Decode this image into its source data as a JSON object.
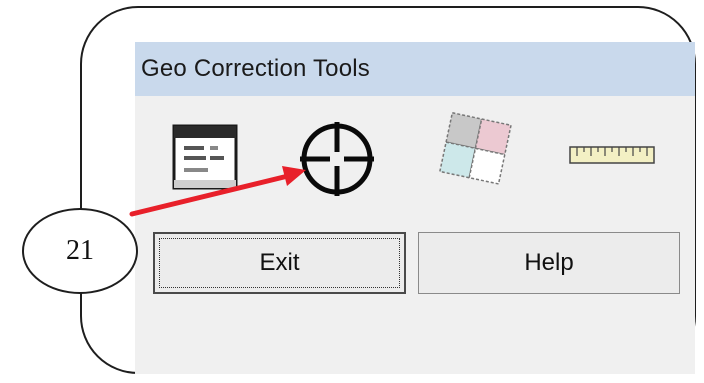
{
  "window": {
    "title": "Geo Correction Tools"
  },
  "toolbar": {
    "tools": [
      {
        "name": "display-resample-settings-tool",
        "icon": "dialog-window-icon"
      },
      {
        "name": "gcp-tool",
        "icon": "crosshair-icon"
      },
      {
        "name": "set-geometric-model-tool",
        "icon": "overlapping-tiles-icon"
      },
      {
        "name": "ruler-tool",
        "icon": "ruler-icon"
      }
    ]
  },
  "buttons": {
    "exit_label": "Exit",
    "help_label": "Help"
  },
  "annotation": {
    "number": "21",
    "color": "#e8202a"
  }
}
